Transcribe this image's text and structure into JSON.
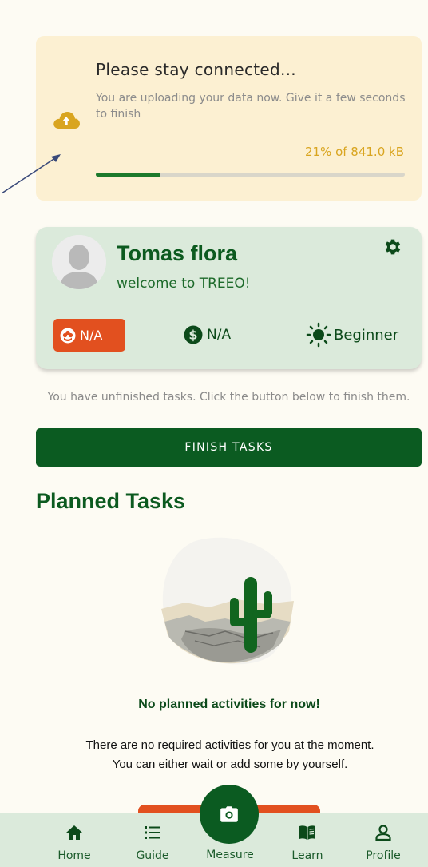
{
  "upload": {
    "title": "Please stay connected...",
    "description": "You are uploading your data now. Give it a few seconds to finish",
    "progress_text": "21% of 841.0 kB",
    "progress_fraction": 0.21,
    "icon": "cloud-upload-icon"
  },
  "profile": {
    "name": "Tomas flora",
    "welcome": "welcome to TREEO!",
    "points_value": "N/A",
    "money_value": "N/A",
    "level_value": "Beginner"
  },
  "tasks": {
    "unfinished_text": "You have unfinished tasks. Click the button below to finish them.",
    "finish_button_label": "FINISH TASKS"
  },
  "planned": {
    "section_title": "Planned Tasks",
    "empty_title": "No planned activities for now!",
    "empty_description": "There are no required activities for you at the moment. You can either wait or add some by yourself."
  },
  "nav": {
    "items": [
      {
        "label": "Home",
        "icon": "home-icon"
      },
      {
        "label": "Guide",
        "icon": "list-icon"
      },
      {
        "label": "Measure",
        "icon": "camera-icon"
      },
      {
        "label": "Learn",
        "icon": "book-icon"
      },
      {
        "label": "Profile",
        "icon": "person-icon"
      }
    ]
  },
  "colors": {
    "brand_green": "#0b5b21",
    "accent_orange": "#e2501f",
    "progress_yellow": "#d9a520",
    "card_cream": "#fcf0d2",
    "card_mint": "#dbeadb"
  }
}
